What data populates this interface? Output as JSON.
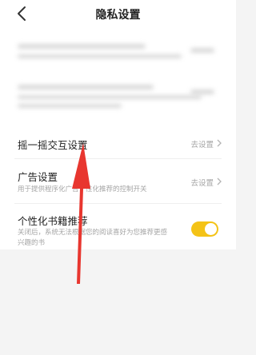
{
  "header": {
    "title": "隐私设置",
    "back_icon": "chevron-left-icon"
  },
  "rows": [
    {
      "title": "摇一摇交互设置",
      "action": "去设置"
    },
    {
      "title": "广告设置",
      "subtitle": "用于提供程序化广告个性化推荐的控制开关",
      "action": "去设置"
    },
    {
      "title": "个性化书籍推荐",
      "subtitle_line1": "关闭后，系统无法根据您的阅读喜好为您推荐更感",
      "subtitle_line2": "兴趣的书",
      "toggle_on": true
    }
  ],
  "colors": {
    "toggle": "#f4c317",
    "arrow": "#e8362f"
  }
}
